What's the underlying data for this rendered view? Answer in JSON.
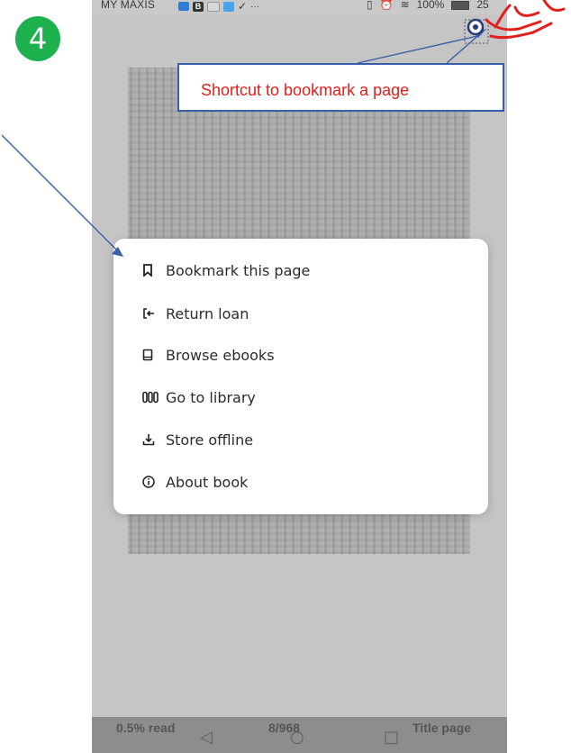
{
  "step_number": "4",
  "status_bar": {
    "carrier": "MY MAXIS",
    "overflow": "···",
    "battery": "100%",
    "time": "25"
  },
  "callout": {
    "text": "Shortcut to bookmark a page"
  },
  "menu": {
    "items": [
      {
        "icon": "bookmark-icon",
        "label": "Bookmark this page"
      },
      {
        "icon": "return-icon",
        "label": "Return loan"
      },
      {
        "icon": "book-icon",
        "label": "Browse ebooks"
      },
      {
        "icon": "library-icon",
        "label": "Go to library"
      },
      {
        "icon": "download-icon",
        "label": "Store offline"
      },
      {
        "icon": "info-icon",
        "label": "About book"
      }
    ]
  },
  "bottom_bar": {
    "read_progress": "0.5% read",
    "page_counter": "8/968",
    "chapter": "Title page"
  },
  "colors": {
    "badge": "#1db24d",
    "callout_border": "#3a5ea8",
    "callout_text": "#e0201c",
    "arrow": "#3a5ea8",
    "hand_annotation": "#e0201c"
  }
}
